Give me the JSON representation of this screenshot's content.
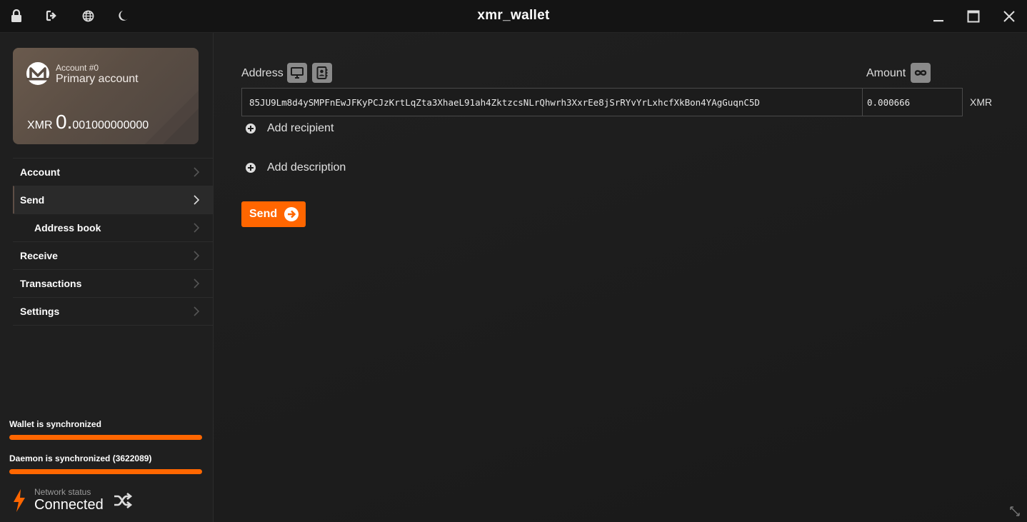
{
  "window": {
    "title": "xmr_wallet",
    "left_icons": [
      "lock-icon",
      "logout-icon",
      "globe-icon",
      "moon-icon"
    ],
    "controls": [
      "minimize-icon",
      "maximize-icon",
      "close-icon"
    ]
  },
  "account_card": {
    "account_number": "Account #0",
    "account_name": "Primary account",
    "currency": "XMR",
    "balance_integer": "0.",
    "balance_fraction": "001000000000"
  },
  "sidebar": {
    "items": [
      {
        "label": "Account",
        "name": "account"
      },
      {
        "label": "Send",
        "name": "send"
      },
      {
        "label": "Address book",
        "name": "address-book"
      },
      {
        "label": "Receive",
        "name": "receive"
      },
      {
        "label": "Transactions",
        "name": "transactions"
      },
      {
        "label": "Settings",
        "name": "settings"
      }
    ],
    "wallet_sync_label": "Wallet is synchronized",
    "wallet_sync_progress": 1.0,
    "daemon_sync_label": "Daemon is synchronized (3622089)",
    "daemon_sync_progress": 1.0,
    "network_status_label": "Network status",
    "network_status_value": "Connected"
  },
  "send_form": {
    "address_label": "Address",
    "address_value": "85JU9Lm8d4ySMPFnEwJFKyPCJzKrtLqZta3XhaeL91ah4ZktzcsNLrQhwrh3XxrEe8jSrRYvYrLxhcfXkBon4YAgGuqnC5D",
    "amount_label": "Amount",
    "amount_value": "0.000666",
    "amount_currency": "XMR",
    "add_recipient_label": "Add recipient",
    "add_description_label": "Add description",
    "send_label": "Send"
  },
  "colors": {
    "accent": "#ff6600",
    "card": "#5b4e44",
    "background": "#1c1c1c"
  }
}
